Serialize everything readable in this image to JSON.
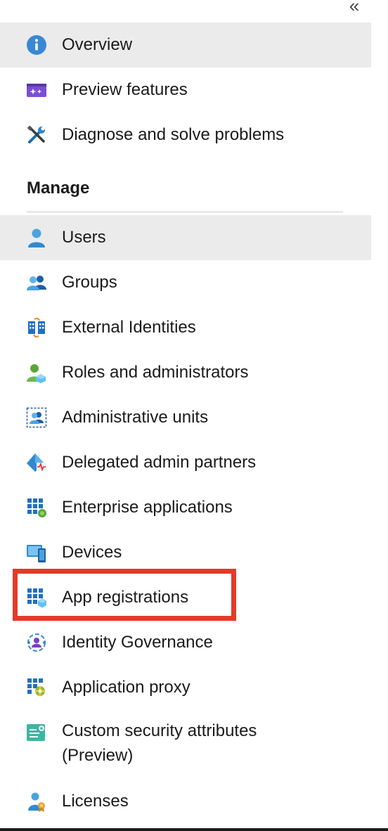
{
  "collapse_icon": "double-chevron-left",
  "top_items": [
    {
      "label": "Overview",
      "icon": "info-icon",
      "selected": true
    },
    {
      "label": "Preview features",
      "icon": "preview-features-icon"
    },
    {
      "label": "Diagnose and solve problems",
      "icon": "wrench-icon"
    }
  ],
  "manage": {
    "title": "Manage",
    "items": [
      {
        "label": "Users",
        "icon": "user-icon",
        "selected": true
      },
      {
        "label": "Groups",
        "icon": "groups-icon"
      },
      {
        "label": "External Identities",
        "icon": "external-identities-icon"
      },
      {
        "label": "Roles and administrators",
        "icon": "roles-icon"
      },
      {
        "label": "Administrative units",
        "icon": "admin-units-icon"
      },
      {
        "label": "Delegated admin partners",
        "icon": "delegated-admin-icon"
      },
      {
        "label": "Enterprise applications",
        "icon": "enterprise-apps-icon"
      },
      {
        "label": "Devices",
        "icon": "devices-icon"
      },
      {
        "label": "App registrations",
        "icon": "app-registrations-icon",
        "highlighted": true
      },
      {
        "label": "Identity Governance",
        "icon": "identity-governance-icon"
      },
      {
        "label": "Application proxy",
        "icon": "application-proxy-icon"
      },
      {
        "label": "Custom security attributes",
        "label_line2": "(Preview)",
        "icon": "custom-security-icon"
      },
      {
        "label": "Licenses",
        "icon": "licenses-icon"
      }
    ]
  },
  "colors": {
    "selected_bg": "#ebebeb",
    "highlight_border": "#e53a2a",
    "azure_blue": "#0078d4"
  }
}
